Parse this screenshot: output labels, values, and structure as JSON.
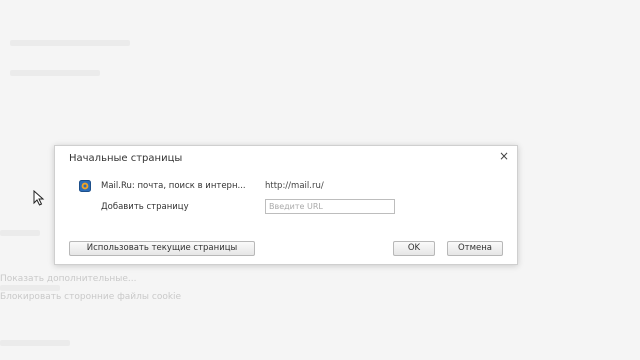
{
  "dialog": {
    "title": "Начальные страницы",
    "close_symbol": "×",
    "pages": [
      {
        "name": "Mail.Ru: почта, поиск в интерн...",
        "url": "http://mail.ru/",
        "icon": "mailru-favicon-icon"
      }
    ],
    "add_page_label": "Добавить страницу",
    "url_input": {
      "placeholder": "Введите URL",
      "value": ""
    },
    "buttons": {
      "use_current": "Использовать текущие страницы",
      "ok": "OK",
      "cancel": "Отмена"
    }
  },
  "background": {
    "texts": [
      "Показать дополнительные...",
      "Блокировать сторонние файлы cookie"
    ]
  },
  "colors": {
    "dialog_bg": "#ffffff",
    "page_bg": "#f5f5f5",
    "button_border": "#b8b8b8"
  }
}
